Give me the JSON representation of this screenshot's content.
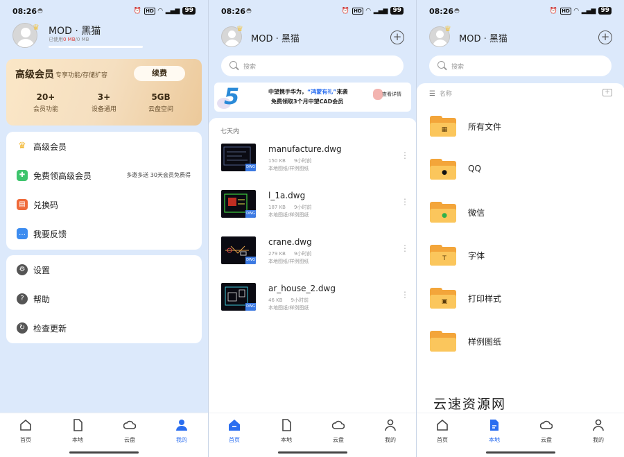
{
  "status": {
    "time": "08:26",
    "battery": "99"
  },
  "profile": {
    "name": "MOD · 黑猫",
    "usage_label": "已使用",
    "usage_used": "0 MB",
    "usage_total": "/0 MB"
  },
  "vip_card": {
    "title": "高级会员",
    "subtitle": "专享功能/存储扩容",
    "button": "续费",
    "stats": [
      {
        "num": "20+",
        "label": "会员功能"
      },
      {
        "num": "3+",
        "label": "设备通用"
      },
      {
        "num": "5GB",
        "label": "云盘空间"
      }
    ]
  },
  "menu1": [
    {
      "label": "高级会员",
      "icon": "crown-icon"
    },
    {
      "label": "免费领高级会员",
      "extra": "多邀多送 30天会员免费得",
      "icon": "gift-icon"
    },
    {
      "label": "兑换码",
      "icon": "ticket-icon"
    },
    {
      "label": "我要反馈",
      "icon": "feedback-icon"
    }
  ],
  "menu2": [
    {
      "label": "设置",
      "icon": "settings-icon"
    },
    {
      "label": "帮助",
      "icon": "help-icon"
    },
    {
      "label": "检查更新",
      "icon": "refresh-icon"
    }
  ],
  "search": {
    "placeholder": "搜索"
  },
  "banner": {
    "number": "5",
    "line1_pre": "中望携手华为，",
    "line1_hl": "“鸿蒙有礼”",
    "line1_post": "来袭",
    "line2": "免费领取3个月中望CAD会员",
    "cta": "查看详情"
  },
  "recent": {
    "title": "七天内",
    "files": [
      {
        "name": "manufacture.dwg",
        "size": "150 KB",
        "time": "9小时前",
        "path": "本地图纸/样例图纸",
        "badge": "DWG"
      },
      {
        "name": "l_1a.dwg",
        "size": "187 KB",
        "time": "9小时前",
        "path": "本地图纸/样例图纸",
        "badge": "DWG"
      },
      {
        "name": "crane.dwg",
        "size": "279 KB",
        "time": "9小时前",
        "path": "本地图纸/样例图纸",
        "badge": "DWG"
      },
      {
        "name": "ar_house_2.dwg",
        "size": "46 KB",
        "time": "9小时前",
        "path": "本地图纸/样例图纸",
        "badge": "DWG"
      }
    ]
  },
  "folders": {
    "sort_label": "名称",
    "items": [
      {
        "name": "所有文件",
        "icon": "all-files-icon"
      },
      {
        "name": "QQ",
        "icon": "qq-icon"
      },
      {
        "name": "微信",
        "icon": "wechat-icon"
      },
      {
        "name": "字体",
        "icon": "font-icon"
      },
      {
        "name": "打印样式",
        "icon": "printer-icon"
      },
      {
        "name": "样例图纸",
        "icon": "sample-folder-icon"
      }
    ]
  },
  "watermark": "云速资源网",
  "nav": [
    "首页",
    "本地",
    "云盘",
    "我的"
  ],
  "colors": {
    "accent": "#2a6ef0",
    "background": "#dce9fb",
    "folder": "#f3a53a",
    "vip_gold": "#f5dfc0"
  }
}
